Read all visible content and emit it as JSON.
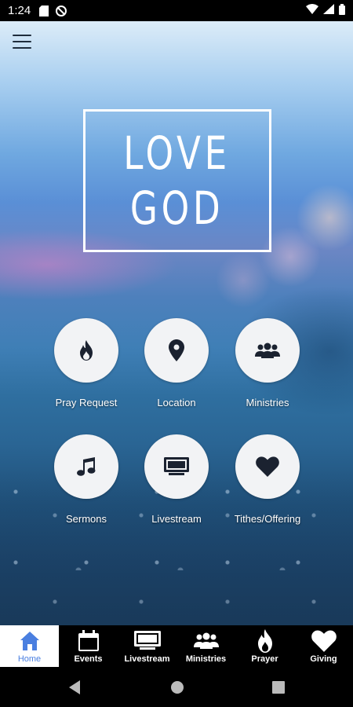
{
  "status_bar": {
    "time": "1:24"
  },
  "hero": {
    "line1": "LOVE",
    "line2": "GOD"
  },
  "tiles": [
    {
      "label": "Pray Request",
      "icon": "flame-icon"
    },
    {
      "label": "Location",
      "icon": "location-pin-icon"
    },
    {
      "label": "Ministries",
      "icon": "group-icon"
    },
    {
      "label": "Sermons",
      "icon": "music-note-icon"
    },
    {
      "label": "Livestream",
      "icon": "monitor-icon"
    },
    {
      "label": "Tithes/Offering",
      "icon": "heart-icon"
    }
  ],
  "bottom_nav": {
    "active_index": 0,
    "active_color": "#4a7fe0",
    "items": [
      {
        "label": "Home",
        "icon": "home-icon"
      },
      {
        "label": "Events",
        "icon": "calendar-icon"
      },
      {
        "label": "Livestream",
        "icon": "monitor-icon"
      },
      {
        "label": "Ministries",
        "icon": "group-icon"
      },
      {
        "label": "Prayer",
        "icon": "flame-icon"
      },
      {
        "label": "Giving",
        "icon": "heart-icon"
      }
    ]
  },
  "colors": {
    "tile_circle": "#f2f3f5",
    "icon_dark": "#1b2230"
  }
}
